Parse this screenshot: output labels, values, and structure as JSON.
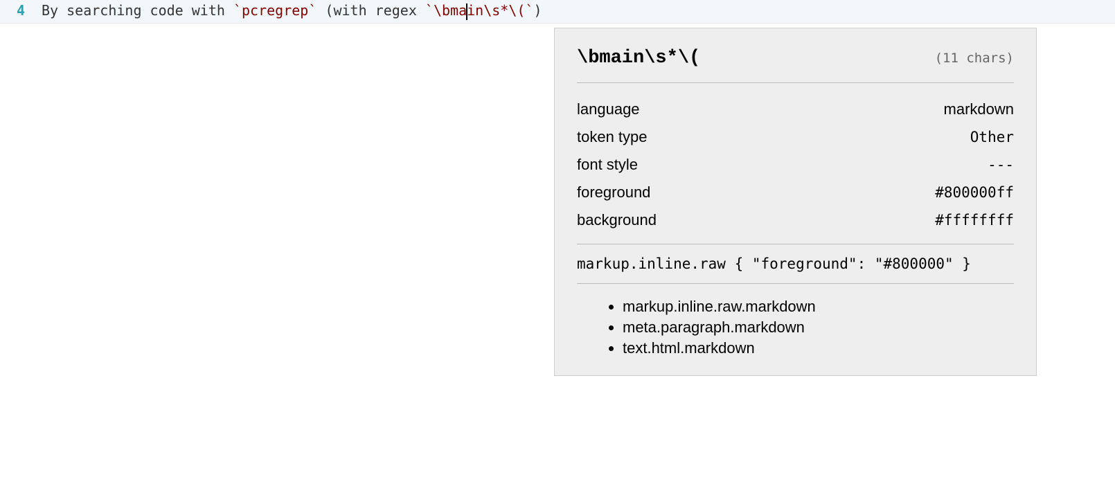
{
  "editor": {
    "line_number": "4",
    "segments": {
      "s0": "By searching code with ",
      "s1": "`",
      "s2": "pcregrep",
      "s3": "`",
      "s4": " (with regex ",
      "s5": "`",
      "s6a": "\\bma",
      "s6b": "in\\s*\\(",
      "s7": "`",
      "s8": ")"
    }
  },
  "tooltip": {
    "title": "\\bmain\\s*\\(",
    "charcount": "(11 chars)",
    "props": [
      {
        "label": "language",
        "value": "markdown",
        "mono": false
      },
      {
        "label": "token type",
        "value": "Other",
        "mono": true
      },
      {
        "label": "font style",
        "value": "---",
        "mono": true
      },
      {
        "label": "foreground",
        "value": "#800000ff",
        "mono": true
      },
      {
        "label": "background",
        "value": "#ffffffff",
        "mono": true
      }
    ],
    "rule": "markup.inline.raw { \"foreground\": \"#800000\" }",
    "scopes": [
      "markup.inline.raw.markdown",
      "meta.paragraph.markdown",
      "text.html.markdown"
    ]
  }
}
